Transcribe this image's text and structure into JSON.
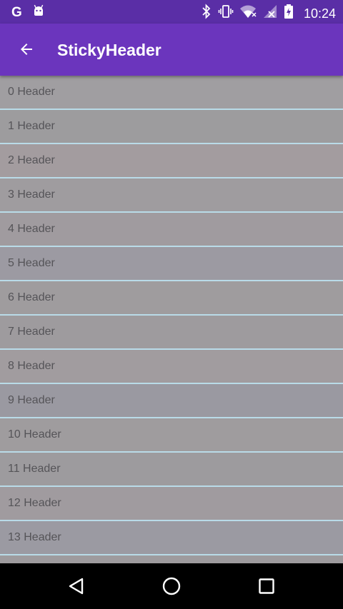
{
  "status_bar": {
    "left_icons": [
      "google-icon",
      "android-icon"
    ],
    "google_letter": "G",
    "right_icons": [
      "bluetooth-icon",
      "vibrate-icon",
      "wifi-icon",
      "no-signal-icon",
      "battery-icon"
    ],
    "time": "10:24"
  },
  "app_bar": {
    "back_icon": "arrow-back-icon",
    "title": "StickyHeader"
  },
  "list": {
    "items": [
      {
        "label": "0 Header",
        "bg": "#a09ea1"
      },
      {
        "label": "1 Header",
        "bg": "#9d9c9e"
      },
      {
        "label": "2 Header",
        "bg": "#a39c9f"
      },
      {
        "label": "3 Header",
        "bg": "#9f9c9f"
      },
      {
        "label": "4 Header",
        "bg": "#a09b9f"
      },
      {
        "label": "5 Header",
        "bg": "#9c9aa2"
      },
      {
        "label": "6 Header",
        "bg": "#9f9c9e"
      },
      {
        "label": "7 Header",
        "bg": "#9e9b9e"
      },
      {
        "label": "8 Header",
        "bg": "#a19c9f"
      },
      {
        "label": "9 Header",
        "bg": "#9a99a1"
      },
      {
        "label": "10 Header",
        "bg": "#9f9c9e"
      },
      {
        "label": "11 Header",
        "bg": "#9d9b9e"
      },
      {
        "label": "12 Header",
        "bg": "#a09b9f"
      },
      {
        "label": "13 Header",
        "bg": "#9b9aa2"
      },
      {
        "label": "",
        "bg": "#9e9b9e"
      }
    ]
  },
  "nav_bar": {
    "buttons": [
      "back-triangle-icon",
      "home-circle-icon",
      "recents-square-icon"
    ]
  },
  "colors": {
    "status_bar": "#5a2ea6",
    "app_bar": "#6b35bd",
    "divider": "#b9dbe8",
    "text": "#555458"
  }
}
